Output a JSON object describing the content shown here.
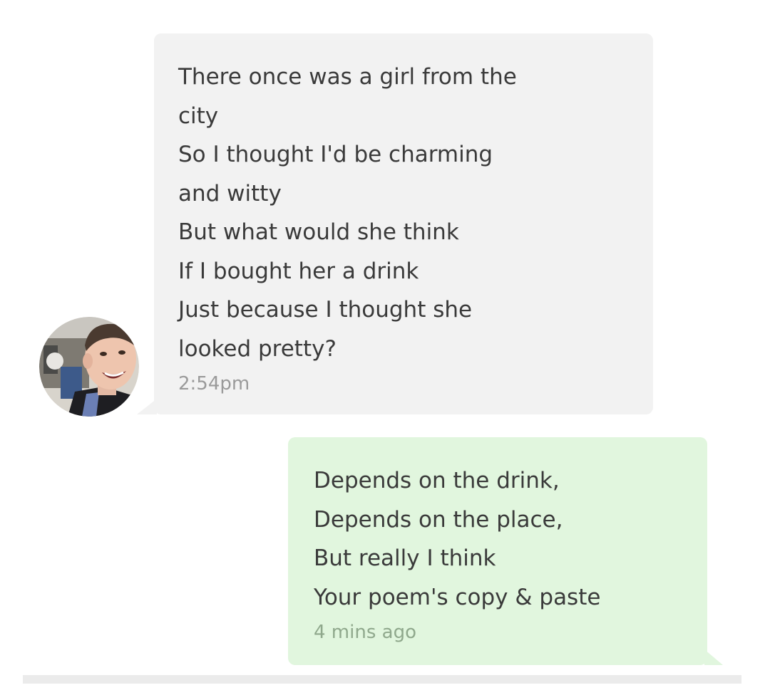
{
  "incoming_message": {
    "lines": [
      "There once was a girl from the",
      "city",
      "So I thought I'd be charming",
      "and witty",
      "But what would she think",
      "If I bought her a drink",
      "Just because I thought she",
      "looked pretty?"
    ],
    "timestamp": "2:54pm"
  },
  "outgoing_message": {
    "lines": [
      "Depends on the drink,",
      "Depends on the place,",
      "But really I think",
      "Your poem's copy & paste"
    ],
    "timestamp": "4 mins ago"
  },
  "colors": {
    "incoming_bubble": "#f2f2f2",
    "outgoing_bubble": "#e1f6de",
    "text": "#3a3a3a",
    "timestamp": "#9a9a9a"
  }
}
